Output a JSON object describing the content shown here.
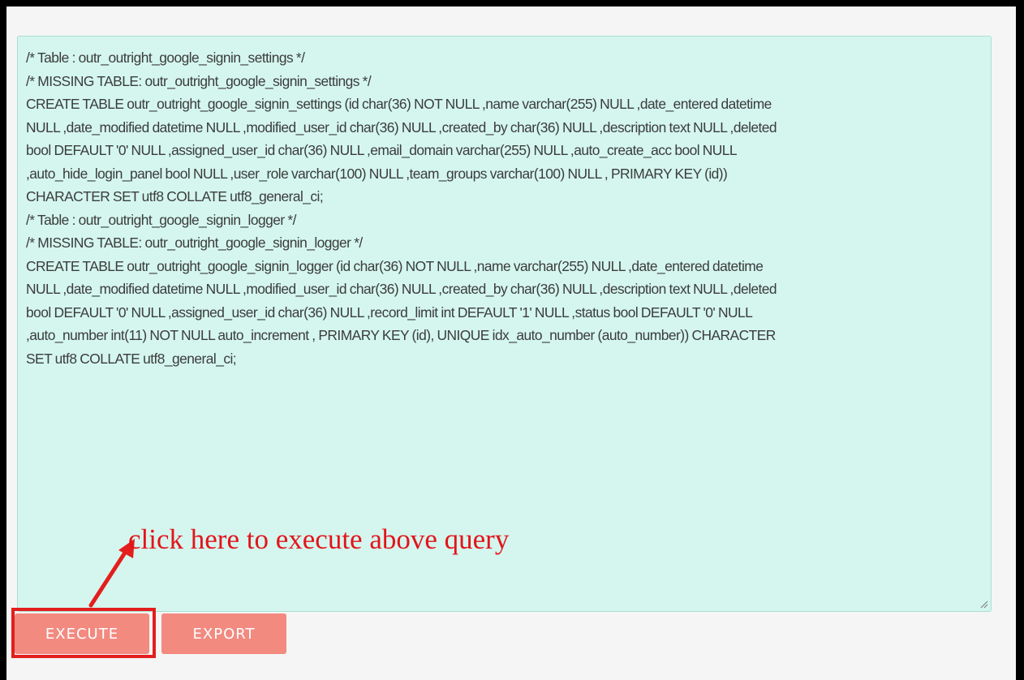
{
  "query_lines": [
    "/* Table : outr_outright_google_signin_settings */",
    "/* MISSING TABLE: outr_outright_google_signin_settings */",
    "CREATE TABLE outr_outright_google_signin_settings (id char(36)  NOT NULL ,name varchar(255)  NULL ,date_entered datetime",
    "NULL ,date_modified datetime  NULL ,modified_user_id char(36)  NULL ,created_by char(36)  NULL ,description text  NULL ,deleted",
    "bool  DEFAULT '0' NULL ,assigned_user_id char(36)  NULL ,email_domain varchar(255)  NULL ,auto_create_acc bool  NULL",
    ",auto_hide_login_panel bool  NULL ,user_role varchar(100)  NULL ,team_groups varchar(100)  NULL  , PRIMARY KEY (id))",
    "CHARACTER SET utf8 COLLATE utf8_general_ci;",
    "/* Table : outr_outright_google_signin_logger */",
    "/* MISSING TABLE: outr_outright_google_signin_logger */",
    "CREATE TABLE outr_outright_google_signin_logger (id char(36)  NOT NULL ,name varchar(255)  NULL ,date_entered datetime",
    "NULL ,date_modified datetime  NULL ,modified_user_id char(36)  NULL ,created_by char(36)  NULL ,description text  NULL ,deleted",
    "bool  DEFAULT '0' NULL ,assigned_user_id char(36)  NULL ,record_limit int  DEFAULT '1' NULL ,status bool  DEFAULT '0' NULL",
    ",auto_number int(11)  NOT NULL auto_increment , PRIMARY KEY (id),   UNIQUE idx_auto_number (auto_number)) CHARACTER",
    "SET utf8 COLLATE utf8_general_ci;"
  ],
  "buttons": {
    "execute": "EXECUTE",
    "export": "EXPORT"
  },
  "annotation": {
    "text": "click here to execute above query"
  },
  "colors": {
    "textarea_bg": "#d4f6ee",
    "button_bg": "#f28a80",
    "annotation_red": "#e3141b"
  }
}
